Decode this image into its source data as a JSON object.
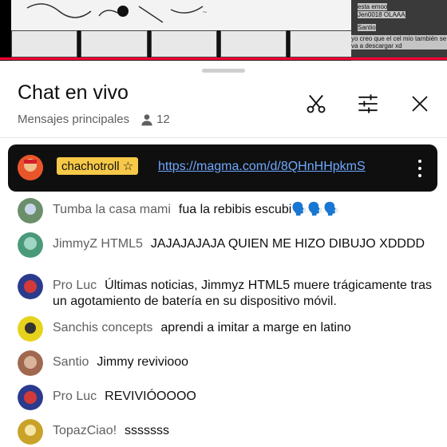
{
  "video": {
    "overlay_lines": [
      "esta emoo",
      "Jen0018 OLAAA",
      "Santio",
      "yo creo que el cel mio también se va a descargar xd"
    ]
  },
  "header": {
    "title": "Chat en vivo",
    "subtitle": "Mensajes principales",
    "viewer_count": "12"
  },
  "pinned": {
    "author": "chachotroll ☆",
    "link": "https://magma.com/d/8QHnHHpkmS"
  },
  "messages": [
    {
      "author": "Tumba la casa mami",
      "text": "fua la rebibis escubi🗣️🗣️🗣️",
      "avatar_color": "#6b8e6b"
    },
    {
      "author": "JimmyZ HTML5",
      "text": "JAJAJAJAJA QUIEN ME HIZO DIBUJO XDDDD",
      "avatar_color": "#4a9a7a"
    },
    {
      "author": "Pro Luc",
      "text": "Últimas noticias, Jimmyz HTML5 muere trágicamente tras un agotamiento de batería en su dispositivo móvil.",
      "avatar_color": "#2b3a8c"
    },
    {
      "author": "Sanchis concepts",
      "text": "aprendi a imitar a marge en latino",
      "avatar_color": "#e6d21c"
    },
    {
      "author": "Santio",
      "text": "Jimmy revivioоо",
      "avatar_color": "#a0684e"
    },
    {
      "author": "Pro Luc",
      "text": "REVIVIÓOOOO",
      "avatar_color": "#2b3a8c"
    },
    {
      "author": "TopazCiao!",
      "text": "sssssss",
      "avatar_color": "#c9a227"
    }
  ],
  "colors": {
    "accent": "#ff0033",
    "link": "#6ea8ff",
    "badge": "#f7c948",
    "secondary_text": "#606060"
  },
  "icons": [
    "scissors-icon",
    "tune-icon",
    "close-icon",
    "person-icon",
    "more-vert-icon"
  ]
}
